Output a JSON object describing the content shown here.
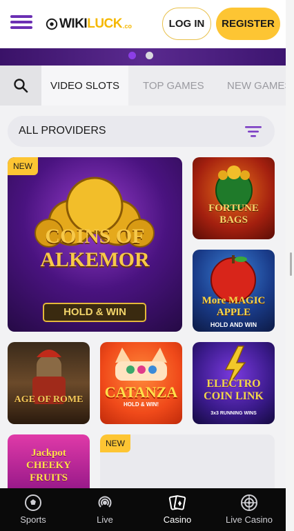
{
  "header": {
    "logo_wiki": "WIKI",
    "logo_luck": "LUCK",
    "logo_co": ".co",
    "login_label": "LOG IN",
    "register_label": "REGISTER"
  },
  "banner": {
    "slides": 2,
    "active_slide": 1
  },
  "tabs": [
    {
      "label": "VIDEO SLOTS",
      "active": true
    },
    {
      "label": "TOP GAMES",
      "active": false
    },
    {
      "label": "NEW GAMES",
      "active": false
    }
  ],
  "providers": {
    "label": "ALL PROVIDERS"
  },
  "games": [
    {
      "title": "COINS OF ALKEMOR",
      "subtitle": "HOLD & WIN",
      "badge": "NEW"
    },
    {
      "title": "FORTUNE BAGS"
    },
    {
      "title": "More MAGIC APPLE",
      "subtitle": "HOLD AND WIN"
    },
    {
      "title": "AGE OF ROME"
    },
    {
      "title": "CATANZA",
      "subtitle": "HOLD & WIN!"
    },
    {
      "title": "ELECTRO COIN LINK",
      "subtitle": "3x3 RUNNING WINS"
    },
    {
      "title": "Jackpot CHEEKY FRUITS"
    },
    {
      "title": "",
      "badge": "NEW"
    }
  ],
  "bottom_nav": [
    {
      "label": "Sports",
      "icon": "soccer-ball-icon"
    },
    {
      "label": "Live",
      "icon": "live-broadcast-icon"
    },
    {
      "label": "Casino",
      "icon": "cards-icon",
      "active": true
    },
    {
      "label": "Live Casino",
      "icon": "roulette-icon"
    }
  ],
  "colors": {
    "accent_purple": "#6b2fb3",
    "accent_yellow": "#fdc533",
    "nav_bg": "#0a0a0a"
  }
}
